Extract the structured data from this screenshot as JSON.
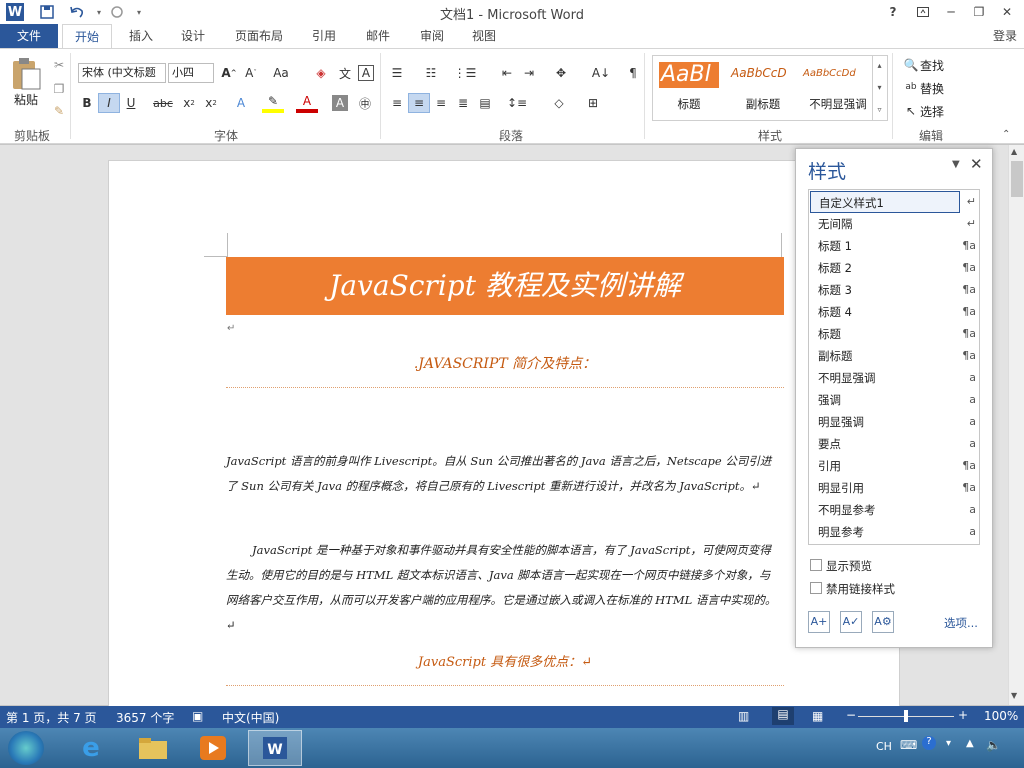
{
  "window": {
    "title": "文档1 - Microsoft Word",
    "help": "?",
    "login": "登录"
  },
  "quick_access": {
    "word_icon": "W",
    "save": "save-icon",
    "undo": "undo-icon",
    "redo": "redo-icon"
  },
  "tabs": [
    "文件",
    "开始",
    "插入",
    "设计",
    "页面布局",
    "引用",
    "邮件",
    "审阅",
    "视图"
  ],
  "ribbon": {
    "paste_label": "粘贴",
    "font_name": "宋体 (中文标题",
    "font_size": "小四",
    "group_labels": {
      "clipboard": "剪贴板",
      "font": "字体",
      "paragraph": "段落",
      "styles": "样式",
      "editing": "编辑"
    },
    "style_gallery": [
      {
        "preview": "AaBl",
        "name": "标题"
      },
      {
        "preview": "AaBbCcD",
        "name": "副标题"
      },
      {
        "preview": "AaBbCcDd",
        "name": "不明显强调"
      }
    ],
    "find": "查找",
    "replace": "替换",
    "select": "选择"
  },
  "document": {
    "title_banner": "JavaScript 教程及实例讲解",
    "heading1": ".JAVASCRIPT 简介及特点：",
    "para1": "JavaScript 语言的前身叫作 Livescript。自从 Sun 公司推出著名的 Java 语言之后，Netscape 公司引进了 Sun 公司有关 Java 的程序概念，将自己原有的 Livescript 重新进行设计，并改名为 JavaScript。↵",
    "para2": "JavaScript 是一种基于对象和事件驱动并具有安全性能的脚本语言，有了 JavaScript，可使网页变得生动。使用它的目的是与 HTML 超文本标识语言、Java 脚本语言一起实现在一个网页中链接多个对象，与网络客户交互作用，从而可以开发客户端的应用程序。它是通过嵌入或调入在标准的 HTML 语言中实现的。↵",
    "heading2": "JavaScript 具有很多优点：↵"
  },
  "styles_pane": {
    "title": "样式",
    "items": [
      {
        "name": "自定义样式1",
        "icon": "↵"
      },
      {
        "name": "无间隔",
        "icon": "↵"
      },
      {
        "name": "标题 1",
        "icon": "¶a"
      },
      {
        "name": "标题 2",
        "icon": "¶a"
      },
      {
        "name": "标题 3",
        "icon": "¶a"
      },
      {
        "name": "标题 4",
        "icon": "¶a"
      },
      {
        "name": "标题",
        "icon": "¶a"
      },
      {
        "name": "副标题",
        "icon": "¶a"
      },
      {
        "name": "不明显强调",
        "icon": "a"
      },
      {
        "name": "强调",
        "icon": "a"
      },
      {
        "name": "明显强调",
        "icon": "a"
      },
      {
        "name": "要点",
        "icon": "a"
      },
      {
        "name": "引用",
        "icon": "¶a"
      },
      {
        "name": "明显引用",
        "icon": "¶a"
      },
      {
        "name": "不明显参考",
        "icon": "a"
      },
      {
        "name": "明显参考",
        "icon": "a"
      }
    ],
    "show_preview": "显示预览",
    "disable_linked": "禁用链接样式",
    "options": "选项..."
  },
  "status": {
    "page": "第 1 页，共 7 页",
    "words": "3657 个字",
    "language": "中文(中国)",
    "zoom": "100%",
    "zoom_level": 0.5
  },
  "tray": {
    "lang": "CH"
  },
  "colors": {
    "accent": "#2b579a",
    "banner": "#ed7d31",
    "heading": "#c55a11"
  }
}
